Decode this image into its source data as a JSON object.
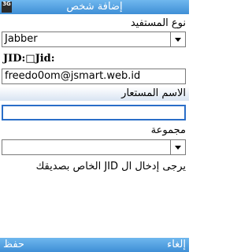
{
  "title": "إضافة شخص",
  "status": {
    "network": "3G"
  },
  "form": {
    "type_label": "نوع المستفيد",
    "type_value": "Jabber",
    "jid_label": "JID:□Jid:",
    "jid_value": "freedo0om@jsmart.web.id",
    "nick_label": "الاسم المستعار",
    "nick_value": "",
    "group_label": "مجموعة",
    "group_value": "",
    "hint": "يرجى إدخال ال JID الخاص بصديقك"
  },
  "softkeys": {
    "left": "حفظ",
    "right": "إلغاء"
  }
}
